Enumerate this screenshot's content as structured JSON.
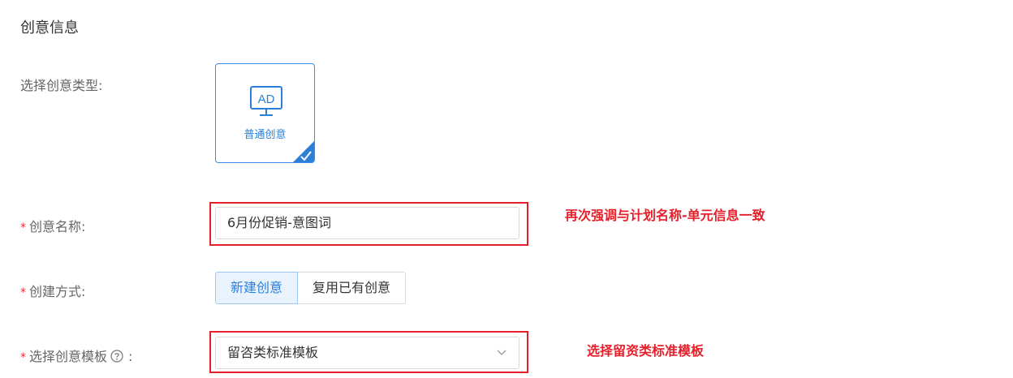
{
  "section": {
    "title": "创意信息"
  },
  "type_field": {
    "label": "选择创意类型:",
    "card_icon_text": "AD",
    "card_label": "普通创意",
    "icon_name": "ad-monitor-icon",
    "selected": true
  },
  "name_field": {
    "required_mark": "*",
    "label": "创意名称:",
    "value": "6月份促销-意图词"
  },
  "method_field": {
    "required_mark": "*",
    "label": "创建方式:",
    "options": [
      "新建创意",
      "复用已有创意"
    ],
    "selected": "新建创意"
  },
  "template_field": {
    "required_mark": "*",
    "label": "选择创意模板",
    "label_suffix": ":",
    "help_icon": "help-circle-icon",
    "value": "留咨类标准模板"
  },
  "annotations": {
    "name_note": "再次强调与计划名称-单元信息一致",
    "template_note": "选择留资类标准模板"
  },
  "colors": {
    "accent": "#2b7fd8",
    "annotation_red": "#e5202b",
    "required": "#e33"
  }
}
